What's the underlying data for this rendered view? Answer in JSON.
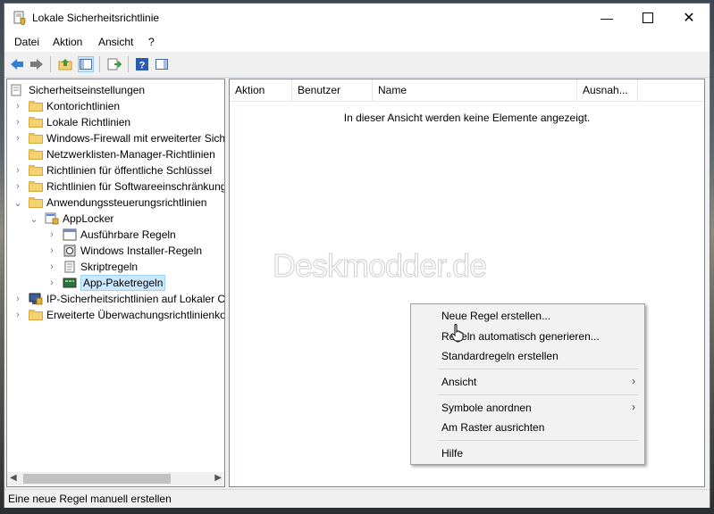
{
  "window": {
    "title": "Lokale Sicherheitsrichtlinie"
  },
  "menu": [
    "Datei",
    "Aktion",
    "Ansicht",
    "?"
  ],
  "toolbar": {
    "icons": [
      "back-arrow-icon",
      "forward-arrow-icon",
      "up-folder-icon",
      "show-hide-console-tree-icon",
      "export-list-icon",
      "help-icon",
      "show-action-pane-icon"
    ]
  },
  "tree": {
    "root": "Sicherheitseinstellungen",
    "items": [
      {
        "label": "Kontorichtlinien"
      },
      {
        "label": "Lokale Richtlinien"
      },
      {
        "label": "Windows-Firewall mit erweiterter Sich"
      },
      {
        "label": "Netzwerklisten-Manager-Richtlinien"
      },
      {
        "label": "Richtlinien für öffentliche Schlüssel"
      },
      {
        "label": "Richtlinien für Softwareeinschränkung"
      },
      {
        "label": "Anwendungssteuerungsrichtlinien"
      },
      {
        "label": "AppLocker"
      },
      {
        "label": "Ausführbare Regeln"
      },
      {
        "label": "Windows Installer-Regeln"
      },
      {
        "label": "Skriptregeln"
      },
      {
        "label": "App-Paketregeln"
      },
      {
        "label": "IP-Sicherheitsrichtlinien auf Lokaler C"
      },
      {
        "label": "Erweiterte Überwachungsrichtlinienko"
      }
    ]
  },
  "list": {
    "columns": [
      "Aktion",
      "Benutzer",
      "Name",
      "Ausnah..."
    ],
    "empty_message": "In dieser Ansicht werden keine Elemente angezeigt.",
    "watermark": "Deskmodder.de"
  },
  "context_menu": {
    "items": [
      "Neue Regel erstellen...",
      "Regeln automatisch generieren...",
      "Standardregeln erstellen",
      "Ansicht",
      "Symbole anordnen",
      "Am Raster ausrichten",
      "Hilfe"
    ]
  },
  "status": {
    "text": "Eine neue Regel manuell erstellen"
  }
}
